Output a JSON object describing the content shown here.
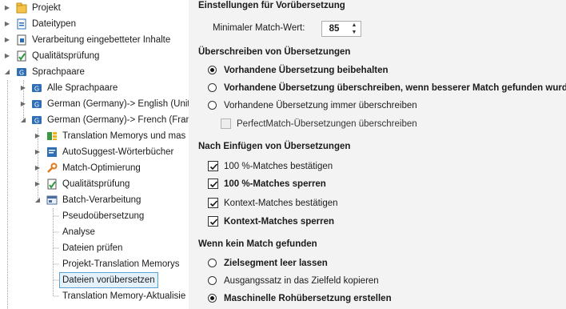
{
  "tree": {
    "items": [
      {
        "label": "Projekt",
        "icon": "project-icon",
        "expander": "collapsed"
      },
      {
        "label": "Dateitypen",
        "icon": "filetypes-icon",
        "expander": "collapsed"
      },
      {
        "label": "Verarbeitung eingebetteter Inhalte",
        "icon": "embedded-content-icon",
        "expander": "collapsed"
      },
      {
        "label": "Qualitätsprüfung",
        "icon": "qa-checklist-icon",
        "expander": "collapsed"
      },
      {
        "label": "Sprachpaare",
        "icon": "language-pairs-icon",
        "expander": "expanded"
      },
      {
        "label": "Alle Sprachpaare",
        "icon": "language-pair-icon",
        "expander": "collapsed"
      },
      {
        "label": "German (Germany)-> English (Unit",
        "icon": "language-pair-icon",
        "expander": "collapsed"
      },
      {
        "label": "German (Germany)-> French (Fran",
        "icon": "language-pair-icon",
        "expander": "expanded"
      },
      {
        "label": "Translation Memorys und mas",
        "icon": "translation-memory-icon",
        "expander": "collapsed"
      },
      {
        "label": "AutoSuggest-Wörterbücher",
        "icon": "autosuggest-icon",
        "expander": "collapsed"
      },
      {
        "label": "Match-Optimierung",
        "icon": "wrench-icon",
        "expander": "collapsed"
      },
      {
        "label": "Qualitätsprüfung",
        "icon": "qa-checklist-icon",
        "expander": "collapsed"
      },
      {
        "label": "Batch-Verarbeitung",
        "icon": "batch-processing-icon",
        "expander": "expanded"
      },
      {
        "label": "Pseudoübersetzung",
        "icon": "",
        "expander": "none"
      },
      {
        "label": "Analyse",
        "icon": "",
        "expander": "none"
      },
      {
        "label": "Dateien prüfen",
        "icon": "",
        "expander": "none"
      },
      {
        "label": "Projekt-Translation Memorys",
        "icon": "",
        "expander": "none"
      },
      {
        "label": "Dateien vorübersetzen",
        "icon": "",
        "expander": "none",
        "selected": true
      },
      {
        "label": "Translation Memory-Aktualisie",
        "icon": "",
        "expander": "none"
      }
    ]
  },
  "settings": {
    "pretranslate_title": "Einstellungen für Vorübersetzung",
    "min_match_label": "Minimaler Match-Wert:",
    "min_match_value": "85",
    "overwrite_title": "Überschreiben von Übersetzungen",
    "overwrite_options": [
      {
        "label": "Vorhandene Übersetzung beibehalten",
        "selected": true
      },
      {
        "label": "Vorhandene Übersetzung überschreiben, wenn besserer Match gefunden wurde",
        "selected": false
      },
      {
        "label": "Vorhandene Übersetzung immer überschreiben",
        "selected": false
      }
    ],
    "perfectmatch_label": "PerfectMatch-Übersetzungen überschreiben",
    "perfectmatch_checked": false,
    "after_insert_title": "Nach Einfügen von Übersetzungen",
    "after_insert_options": [
      {
        "label": "100 %-Matches bestätigen",
        "checked": true
      },
      {
        "label": "100 %-Matches sperren",
        "checked": true
      },
      {
        "label": "Kontext-Matches bestätigen",
        "checked": true
      },
      {
        "label": "Kontext-Matches sperren",
        "checked": true
      }
    ],
    "no_match_title": "Wenn kein Match gefunden",
    "no_match_options": [
      {
        "label": "Zielsegment leer lassen",
        "selected": false
      },
      {
        "label": "Ausgangssatz in das Zielfeld kopieren",
        "selected": false
      },
      {
        "label": "Maschinelle Rohübersetzung erstellen",
        "selected": true
      }
    ]
  },
  "colors": {
    "panel_bg": "#f3f3f3",
    "selection_border": "#5aa2d8",
    "selection_fill": "#e5f1fb"
  }
}
